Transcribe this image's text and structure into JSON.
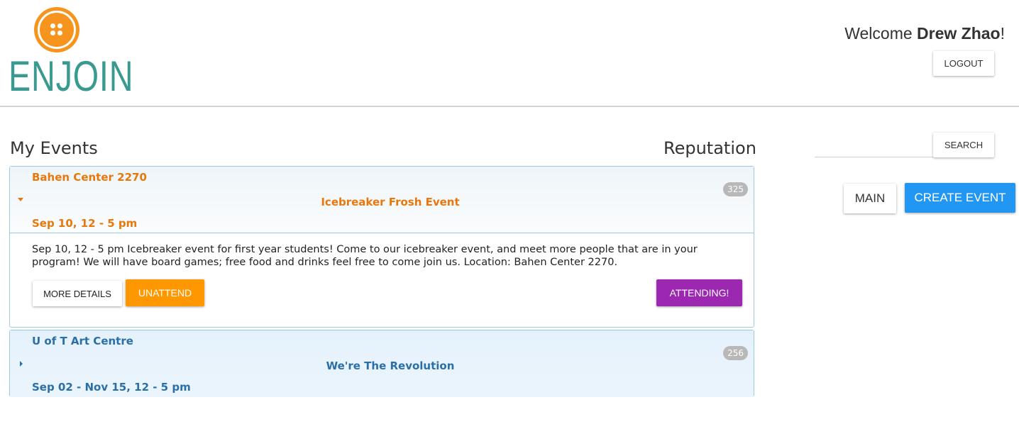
{
  "brand": {
    "logo_text": "ENJOIN",
    "accent_orange": "#f7941d",
    "logo_teal": "#3a9a8f"
  },
  "header": {
    "welcome_prefix": "Welcome ",
    "user_name": "Drew Zhao",
    "welcome_suffix": "!",
    "logout_label": "LOGOUT"
  },
  "main": {
    "heading": "My Events",
    "reputation_label": "Reputation",
    "events": [
      {
        "location": "Bahen Center 2270",
        "title": "Icebreaker Frosh Event",
        "date": "Sep 10, 12 - 5 pm",
        "reputation": "325",
        "expanded": true,
        "description": "Sep 10, 12 - 5 pm Icebreaker event for first year students! Come to our icebreaker event, and meet more people that are in your program! We will have board games; free food and drinks feel free to come join us. Location: Bahen Center 2270.",
        "more_details_label": "MORE DETAILS",
        "unattend_label": "UNATTEND",
        "status_label": "ATTENDING!"
      },
      {
        "location": "U of T Art Centre",
        "title": "We're The Revolution",
        "date": "Sep 02 - Nov 15, 12 - 5 pm",
        "reputation": "256",
        "expanded": false
      }
    ]
  },
  "sidebar": {
    "search_placeholder": "",
    "search_label": "SEARCH",
    "main_label": "MAIN",
    "create_event_label": "CREATE EVENT"
  },
  "colors": {
    "unattend": "#ff9800",
    "attending": "#9c27b0",
    "create_event": "#2196f3"
  }
}
